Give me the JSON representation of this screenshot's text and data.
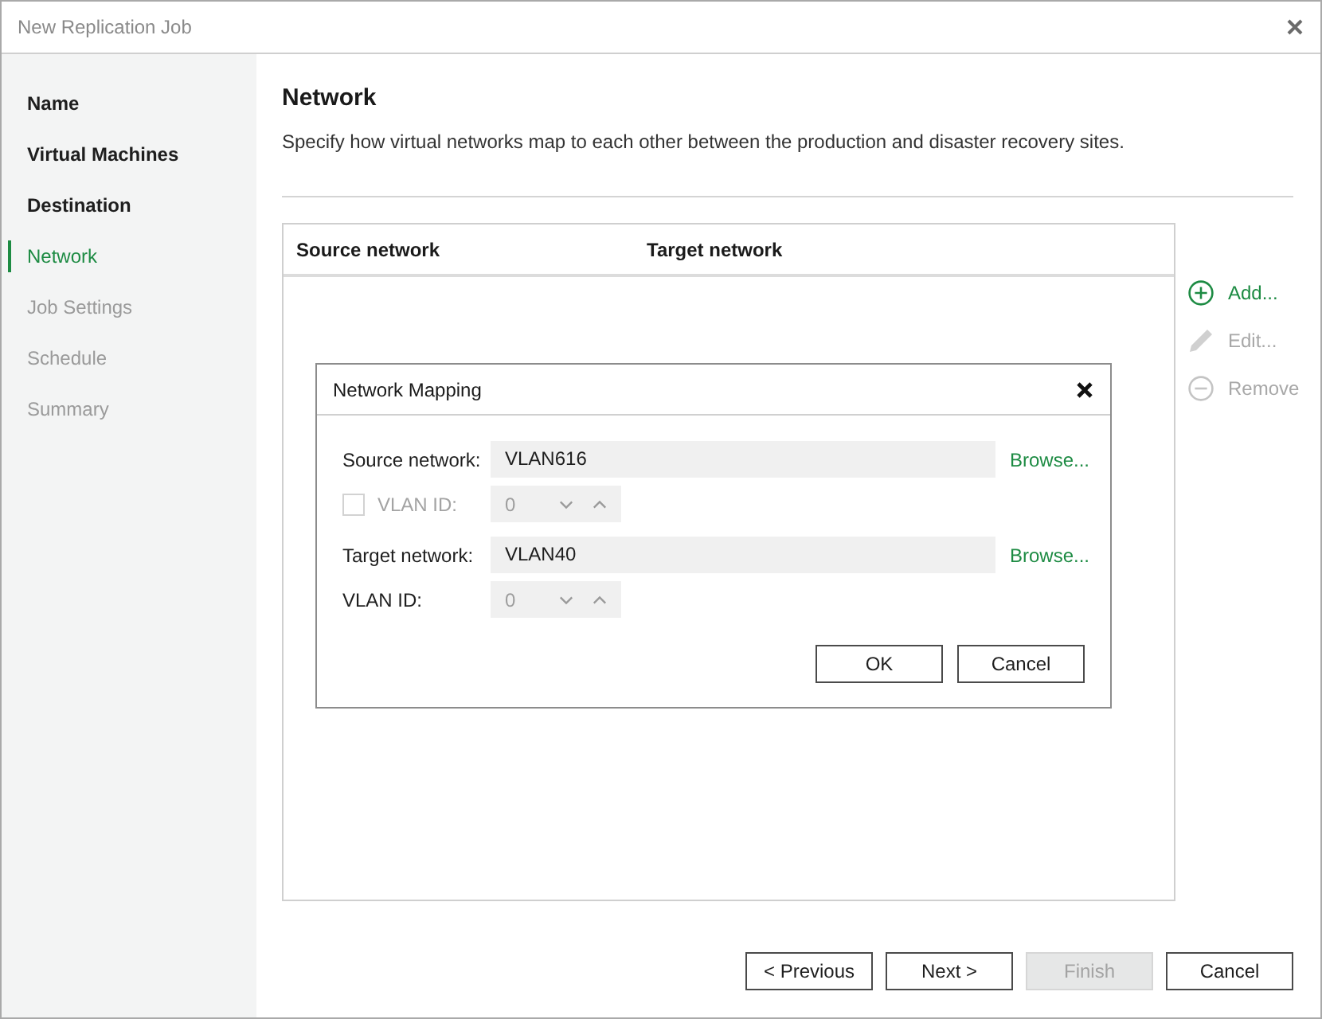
{
  "window": {
    "title": "New Replication Job"
  },
  "steps": [
    {
      "label": "Name",
      "selected": false,
      "disabled": false
    },
    {
      "label": "Virtual Machines",
      "selected": false,
      "disabled": false
    },
    {
      "label": "Destination",
      "selected": false,
      "disabled": false
    },
    {
      "label": "Network",
      "selected": true,
      "disabled": false
    },
    {
      "label": "Job Settings",
      "selected": false,
      "disabled": true
    },
    {
      "label": "Schedule",
      "selected": false,
      "disabled": true
    },
    {
      "label": "Summary",
      "selected": false,
      "disabled": true
    }
  ],
  "page": {
    "title": "Network",
    "description": "Specify how virtual networks map to each other between the production and disaster recovery sites."
  },
  "table": {
    "columns": [
      "Source network",
      "Target network"
    ]
  },
  "actions": [
    {
      "kind": "add",
      "label": "Add...",
      "disabled": false
    },
    {
      "kind": "edit",
      "label": "Edit...",
      "disabled": true
    },
    {
      "kind": "remove",
      "label": "Remove",
      "disabled": true
    }
  ],
  "dialog": {
    "title": "Network Mapping",
    "rows": [
      {
        "kind": "network",
        "label": "Source network:",
        "value": "VLAN616",
        "link": "Browse..."
      },
      {
        "kind": "vlan",
        "label": "VLAN ID:",
        "value": "0",
        "checked": false,
        "disabled": true
      },
      {
        "kind": "network",
        "label": "Target network:",
        "value": "VLAN40",
        "link": "Browse..."
      },
      {
        "kind": "vlan",
        "label": "VLAN ID:",
        "value": "0",
        "disabled": false
      }
    ],
    "buttons": [
      {
        "label": "OK"
      },
      {
        "label": "Cancel"
      }
    ]
  },
  "footer": {
    "buttons": [
      {
        "label": "< Previous",
        "disabled": false
      },
      {
        "label": "Next >",
        "disabled": false
      },
      {
        "label": "Finish",
        "disabled": true
      },
      {
        "label": "Cancel",
        "disabled": false
      }
    ]
  }
}
